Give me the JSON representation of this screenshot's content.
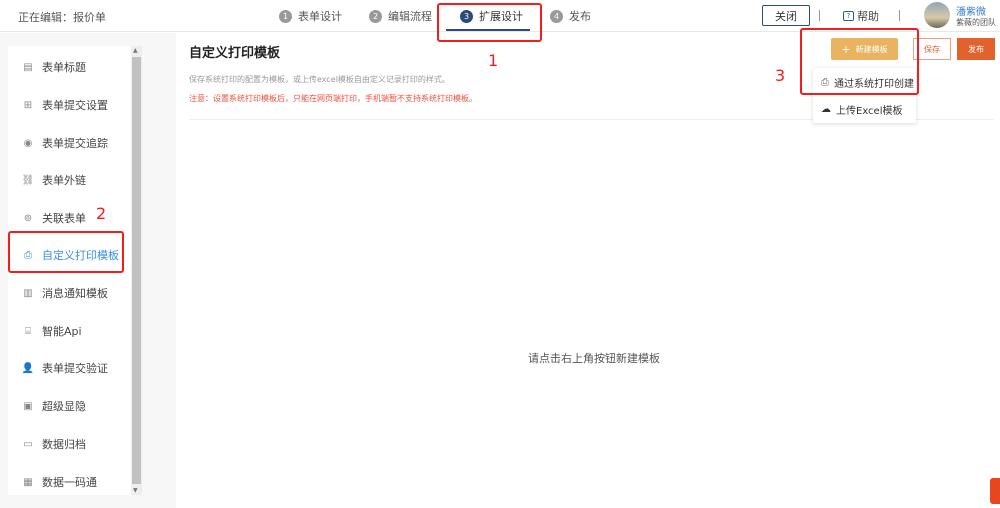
{
  "header": {
    "editing_label": "正在编辑：",
    "form_name": "报价单",
    "steps": [
      {
        "num": "1",
        "label": "表单设计"
      },
      {
        "num": "2",
        "label": "编辑流程"
      },
      {
        "num": "3",
        "label": "扩展设计"
      },
      {
        "num": "4",
        "label": "发布"
      }
    ],
    "close_label": "关闭",
    "help_label": "帮助",
    "user_name": "潘紫微",
    "team_name": "紫薇的团队"
  },
  "sidebar": {
    "items": [
      {
        "label": "表单标题",
        "icon": "▤"
      },
      {
        "label": "表单提交设置",
        "icon": "⊞"
      },
      {
        "label": "表单提交追踪",
        "icon": "◉"
      },
      {
        "label": "表单外链",
        "icon": "⛓"
      },
      {
        "label": "关联表单",
        "icon": "⊚"
      },
      {
        "label": "自定义打印模板",
        "icon": "⎙"
      },
      {
        "label": "消息通知模板",
        "icon": "▥"
      },
      {
        "label": "智能Api",
        "icon": "⌸"
      },
      {
        "label": "表单提交验证",
        "icon": "👤"
      },
      {
        "label": "超级显隐",
        "icon": "▣"
      },
      {
        "label": "数据归档",
        "icon": "▭"
      },
      {
        "label": "数据一码通",
        "icon": "▦"
      }
    ],
    "active_index": 5
  },
  "main": {
    "title": "自定义打印模板",
    "description": "保存系统打印的配置为模板，或上传excel模板自由定义记录打印的样式。",
    "warning": "注意：设置系统打印模板后，只能在网页端打印，手机端暂不支持系统打印模板。",
    "empty_text": "请点击右上角按钮新建模板",
    "new_template_label": "新建模板",
    "save_label": "保存",
    "publish_label": "发布",
    "dropdown": [
      {
        "label": "通过系统打印创建",
        "icon": "⎙"
      },
      {
        "label": "上传Excel模板",
        "icon": "☁"
      }
    ]
  },
  "annotations": [
    "1",
    "2",
    "3"
  ],
  "colors": {
    "accent": "#2d4a7a",
    "active": "#3a8ee6",
    "orange": "#e9b360",
    "publish": "#e2622e",
    "annotation": "#f21d1d"
  }
}
